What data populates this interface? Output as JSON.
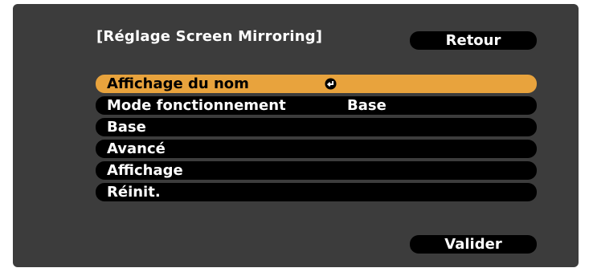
{
  "header": {
    "title": "[Réglage Screen Mirroring]",
    "back_label": "Retour"
  },
  "menu": {
    "items": [
      {
        "label": "Affichage du nom",
        "value": "",
        "icon": "enter-icon",
        "selected": true
      },
      {
        "label": "Mode fonctionnement",
        "value": "Base",
        "selected": false
      },
      {
        "label": "Base",
        "value": "",
        "selected": false
      },
      {
        "label": "Avancé",
        "value": "",
        "selected": false
      },
      {
        "label": "Affichage",
        "value": "",
        "selected": false
      },
      {
        "label": "Réinit.",
        "value": "",
        "selected": false
      }
    ]
  },
  "footer": {
    "confirm_label": "Valider"
  },
  "colors": {
    "panel": "#3c3c3c",
    "row_bg": "#000000",
    "highlight": "#e8a33d",
    "text": "#ffffff"
  }
}
